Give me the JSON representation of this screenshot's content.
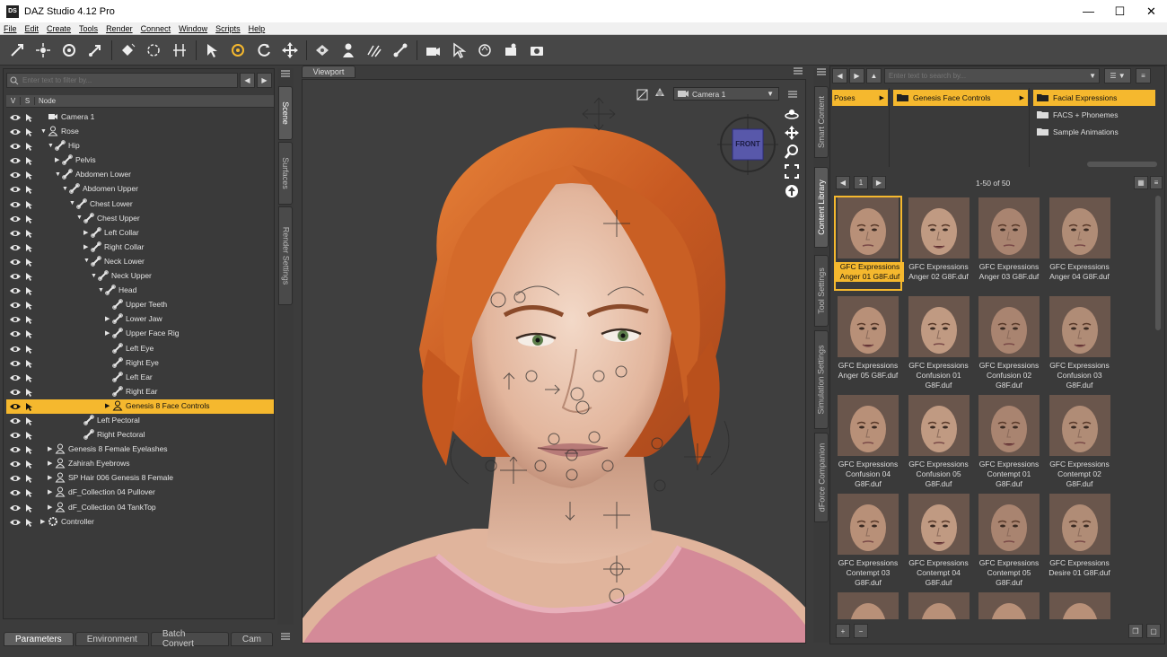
{
  "window": {
    "title": "DAZ Studio 4.12 Pro",
    "logo": "DS"
  },
  "menu": [
    "File",
    "Edit",
    "Create",
    "Tools",
    "Render",
    "Connect",
    "Window",
    "Scripts",
    "Help"
  ],
  "toolbar_icons": [
    "universal-tool-icon",
    "node-weight-brush-icon",
    "rotate-tool-icon",
    "translate-tool-icon",
    "surface-selection-icon",
    "spot-render-icon",
    "joint-editor-icon",
    "node-selection-icon",
    "active-pose-icon",
    "rotate-icon",
    "move-icon",
    "region-navigator-icon",
    "figure-icon",
    "geometry-editor-icon",
    "transform-icon",
    "camera-icon",
    "pointer-icon",
    "scene-icon",
    "lighting-icon",
    "render-icon"
  ],
  "scene": {
    "filter_placeholder": "Enter text to filter by...",
    "col_v": "V",
    "col_s": "S",
    "col_node": "Node",
    "nodes": [
      {
        "label": "Camera 1",
        "depth": 0,
        "tri": "",
        "icon": "camera"
      },
      {
        "label": "Rose",
        "depth": 0,
        "tri": "▼",
        "icon": "figure"
      },
      {
        "label": "Hip",
        "depth": 1,
        "tri": "▼",
        "icon": "bone"
      },
      {
        "label": "Pelvis",
        "depth": 2,
        "tri": "▶",
        "icon": "bone"
      },
      {
        "label": "Abdomen Lower",
        "depth": 2,
        "tri": "▼",
        "icon": "bone"
      },
      {
        "label": "Abdomen Upper",
        "depth": 3,
        "tri": "▼",
        "icon": "bone"
      },
      {
        "label": "Chest Lower",
        "depth": 4,
        "tri": "▼",
        "icon": "bone"
      },
      {
        "label": "Chest Upper",
        "depth": 5,
        "tri": "▼",
        "icon": "bone"
      },
      {
        "label": "Left Collar",
        "depth": 6,
        "tri": "▶",
        "icon": "bone"
      },
      {
        "label": "Right Collar",
        "depth": 6,
        "tri": "▶",
        "icon": "bone"
      },
      {
        "label": "Neck Lower",
        "depth": 6,
        "tri": "▼",
        "icon": "bone"
      },
      {
        "label": "Neck Upper",
        "depth": 7,
        "tri": "▼",
        "icon": "bone"
      },
      {
        "label": "Head",
        "depth": 8,
        "tri": "▼",
        "icon": "bone"
      },
      {
        "label": "Upper Teeth",
        "depth": 9,
        "tri": "",
        "icon": "bone"
      },
      {
        "label": "Lower Jaw",
        "depth": 9,
        "tri": "▶",
        "icon": "bone"
      },
      {
        "label": "Upper Face Rig",
        "depth": 9,
        "tri": "▶",
        "icon": "bone"
      },
      {
        "label": "Left Eye",
        "depth": 9,
        "tri": "",
        "icon": "bone"
      },
      {
        "label": "Right Eye",
        "depth": 9,
        "tri": "",
        "icon": "bone"
      },
      {
        "label": "Left Ear",
        "depth": 9,
        "tri": "",
        "icon": "bone"
      },
      {
        "label": "Right Ear",
        "depth": 9,
        "tri": "",
        "icon": "bone"
      },
      {
        "label": "Genesis 8 Face Controls",
        "depth": 9,
        "tri": "▶",
        "icon": "figure",
        "selected": true
      },
      {
        "label": "Left Pectoral",
        "depth": 5,
        "tri": "",
        "icon": "bone"
      },
      {
        "label": "Right Pectoral",
        "depth": 5,
        "tri": "",
        "icon": "bone"
      },
      {
        "label": "Genesis 8 Female Eyelashes",
        "depth": 1,
        "tri": "▶",
        "icon": "figure"
      },
      {
        "label": "Zahirah Eyebrows",
        "depth": 1,
        "tri": "▶",
        "icon": "figure"
      },
      {
        "label": "SP Hair 006 Genesis 8 Female",
        "depth": 1,
        "tri": "▶",
        "icon": "figure"
      },
      {
        "label": "dF_Collection 04 Pullover",
        "depth": 1,
        "tri": "▶",
        "icon": "figure"
      },
      {
        "label": "dF_Collection 04 TankTop",
        "depth": 1,
        "tri": "▶",
        "icon": "figure"
      },
      {
        "label": "Controller",
        "depth": 0,
        "tri": "▶",
        "icon": "gear"
      }
    ]
  },
  "left_vtabs": [
    "Scene",
    "Surfaces",
    "Render Settings"
  ],
  "bottom_tabs": [
    "Parameters",
    "Environment",
    "Batch Convert",
    "Cam"
  ],
  "viewport": {
    "tab": "Viewport",
    "camera": "Camera 1",
    "cube_label": "FRONT"
  },
  "right_vtabs": [
    "Smart Content",
    "Content Library",
    "Tool Settings",
    "Simulation Settings",
    "dForce Companion"
  ],
  "content_library": {
    "search_placeholder": "Enter text to search by...",
    "categories": {
      "col1": [
        "Poses"
      ],
      "col2": [
        "Genesis Face Controls"
      ],
      "col3": [
        "Facial Expressions",
        "FACS + Phonemes",
        "Sample Animations"
      ]
    },
    "page": "1",
    "count": "1-50 of 50",
    "items": [
      "GFC Expressions Anger 01 G8F.duf",
      "GFC Expressions Anger 02 G8F.duf",
      "GFC Expressions Anger 03 G8F.duf",
      "GFC Expressions Anger 04 G8F.duf",
      "GFC Expressions Anger 05 G8F.duf",
      "GFC Expressions Confusion 01 G8F.duf",
      "GFC Expressions Confusion 02 G8F.duf",
      "GFC Expressions Confusion 03 G8F.duf",
      "GFC Expressions Confusion 04 G8F.duf",
      "GFC Expressions Confusion 05 G8F.duf",
      "GFC Expressions Contempt 01 G8F.duf",
      "GFC Expressions Contempt 02 G8F.duf",
      "GFC Expressions Contempt 03 G8F.duf",
      "GFC Expressions Contempt 04 G8F.duf",
      "GFC Expressions Contempt 05 G8F.duf",
      "GFC Expressions Desire 01 G8F.duf"
    ]
  },
  "colors": {
    "accent": "#f5b82e",
    "panel": "#3a3a3a",
    "hair": "#d86a2a"
  }
}
